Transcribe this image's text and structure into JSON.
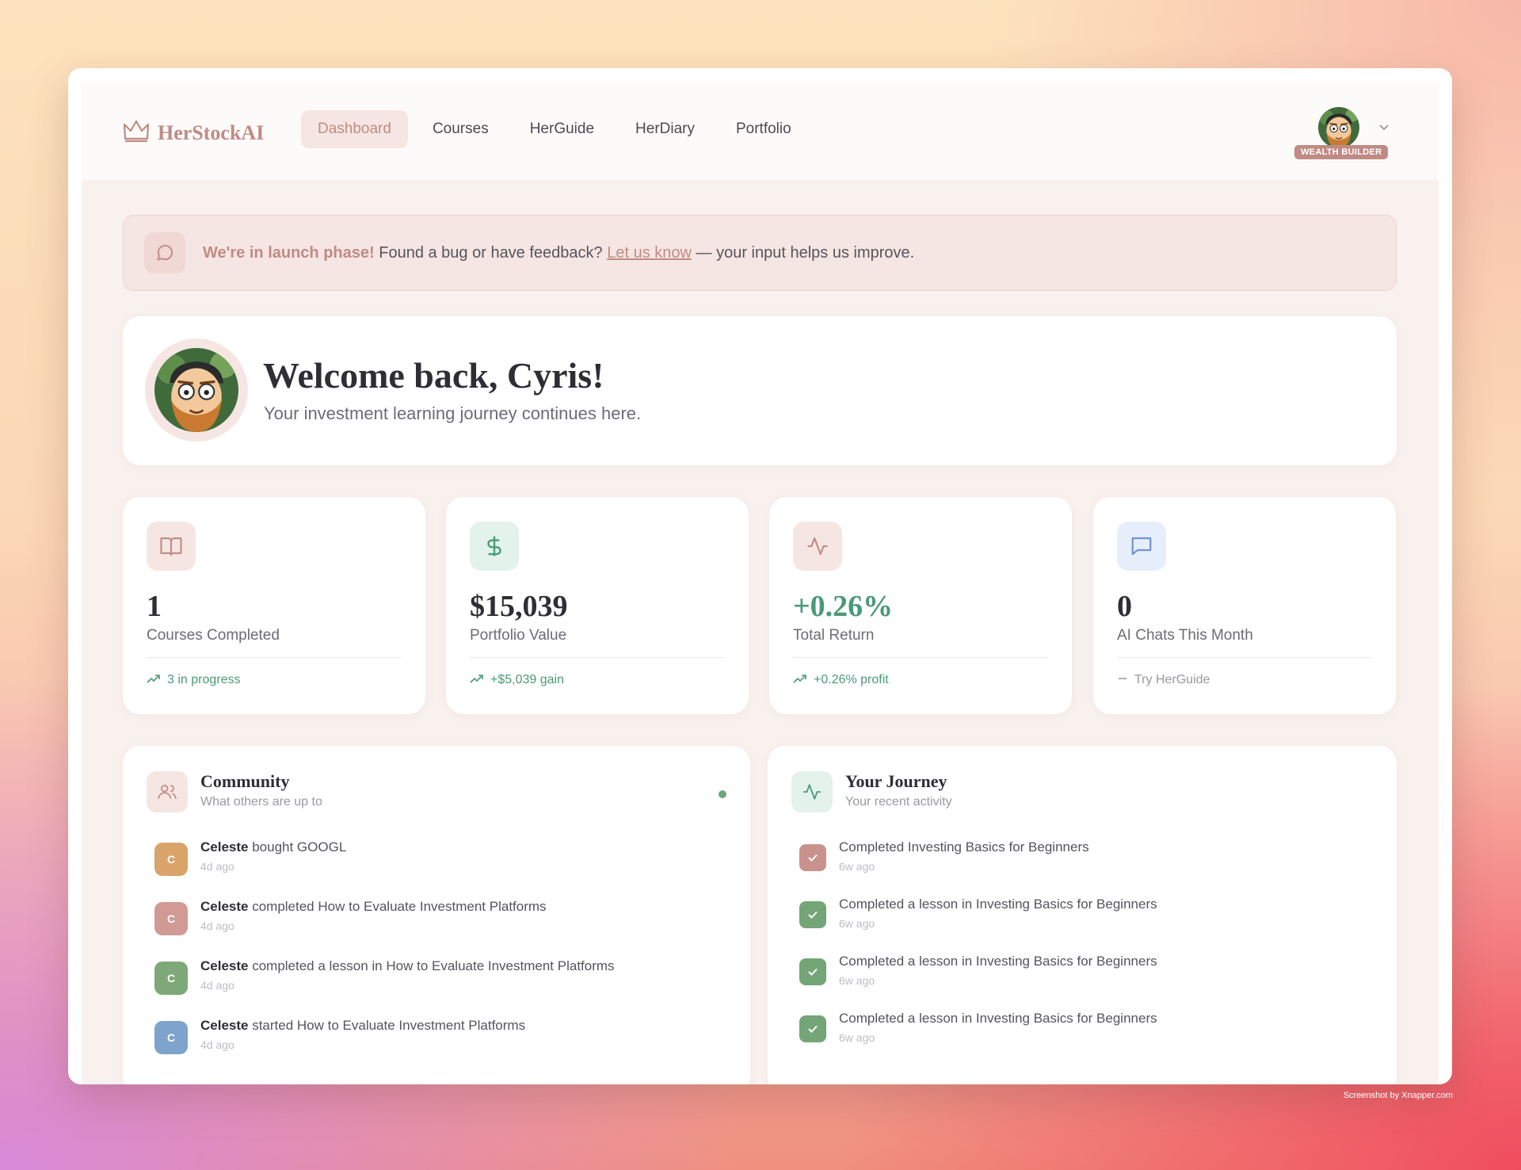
{
  "app": {
    "name": "HerStockAI",
    "colors": {
      "accent": "#c08b85",
      "green": "#4a9a78",
      "blue": "#6f94d6"
    }
  },
  "nav": {
    "links": [
      "Dashboard",
      "Courses",
      "HerGuide",
      "HerDiary",
      "Portfolio"
    ],
    "active": "Dashboard",
    "badge": "WEALTH BUILDER"
  },
  "banner": {
    "strong": "We're in launch phase!",
    "text1": " Found a bug or have feedback? ",
    "link": "Let us know",
    "text2": " — your input helps us improve."
  },
  "welcome": {
    "title": "Welcome back, Cyris!",
    "subtitle": "Your investment learning journey continues here."
  },
  "stats": [
    {
      "value": "1",
      "label": "Courses Completed",
      "foot": "3 in progress",
      "icon": "book-icon"
    },
    {
      "value": "$15,039",
      "label": "Portfolio Value",
      "foot": "+$5,039 gain",
      "icon": "dollar-icon"
    },
    {
      "value": "+0.26%",
      "label": "Total Return",
      "foot": "+0.26% profit",
      "icon": "activity-icon"
    },
    {
      "value": "0",
      "label": "AI Chats This Month",
      "foot": "Try HerGuide",
      "icon": "chat-icon"
    }
  ],
  "community": {
    "title": "Community",
    "subtitle": "What others are up to",
    "items": [
      {
        "initial": "C",
        "name": "Celeste",
        "action": " bought GOOGL",
        "time": "4d ago",
        "color": "#d9a36a"
      },
      {
        "initial": "C",
        "name": "Celeste",
        "action": " completed How to Evaluate Investment Platforms",
        "time": "4d ago",
        "color": "#d19a95"
      },
      {
        "initial": "C",
        "name": "Celeste",
        "action": " completed a lesson in How to Evaluate Investment Platforms",
        "time": "4d ago",
        "color": "#7ea878"
      },
      {
        "initial": "C",
        "name": "Celeste",
        "action": " started How to Evaluate Investment Platforms",
        "time": "4d ago",
        "color": "#7ea3cc"
      }
    ]
  },
  "journey": {
    "title": "Your Journey",
    "subtitle": "Your recent activity",
    "items": [
      {
        "text": "Completed Investing Basics for Beginners",
        "time": "6w ago",
        "color": "#c9928c"
      },
      {
        "text": "Completed a lesson in Investing Basics for Beginners",
        "time": "6w ago",
        "color": "#73a577"
      },
      {
        "text": "Completed a lesson in Investing Basics for Beginners",
        "time": "6w ago",
        "color": "#73a577"
      },
      {
        "text": "Completed a lesson in Investing Basics for Beginners",
        "time": "6w ago",
        "color": "#73a577"
      }
    ]
  },
  "credit": "Screenshot by Xnapper.com"
}
